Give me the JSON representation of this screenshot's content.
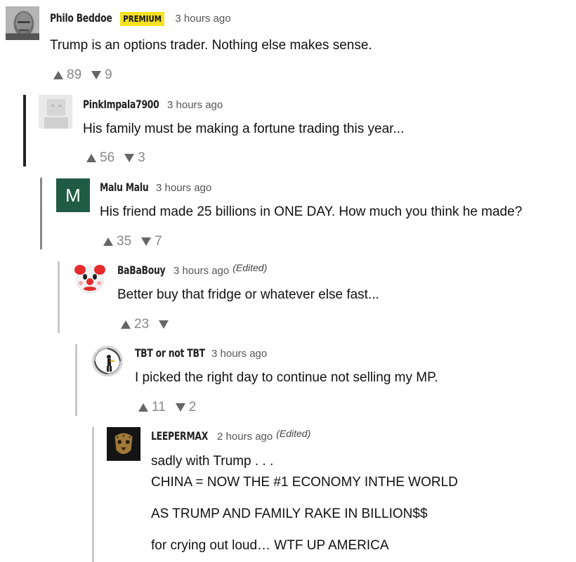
{
  "comments": [
    {
      "author": "Philo Beddoe",
      "badge": "PREMIUM",
      "time": "3 hours ago",
      "text": "Trump is an options trader. Nothing else makes sense.",
      "up": "89",
      "down": "9"
    },
    {
      "author": "PinkImpala7900",
      "time": "3 hours ago",
      "text": "His family must be making a fortune trading this year...",
      "up": "56",
      "down": "3"
    },
    {
      "author": "Malu Malu",
      "avatar_letter": "M",
      "time": "3 hours ago",
      "text": "His friend made 25 billions in ONE DAY. How much you think he made?",
      "up": "35",
      "down": "7"
    },
    {
      "author": "BaBaBouy",
      "time": "3 hours ago",
      "edited": "(Edited)",
      "text": "Better buy that fridge or whatever else fast...",
      "up": "23",
      "down": ""
    },
    {
      "author": "TBT or not TBT",
      "time": "3 hours ago",
      "text": "I picked the right day to continue not selling my MP.",
      "up": "11",
      "down": "2"
    },
    {
      "author": "LEEPERMAX",
      "time": "2 hours ago",
      "edited": "(Edited)",
      "lines": [
        "sadly with Trump . . .",
        "CHINA = NOW THE #1 ECONOMY INTHE WORLD",
        "AS TRUMP AND FAMILY RAKE IN BILLION$$",
        "for crying out loud… WTF UP AMERICA"
      ]
    }
  ],
  "colors": {
    "badge": "#f6e21f",
    "malu_avatar": "#1f5b45",
    "vote_grey": "#888888"
  },
  "icons": [
    "upvote-icon",
    "downvote-icon"
  ]
}
